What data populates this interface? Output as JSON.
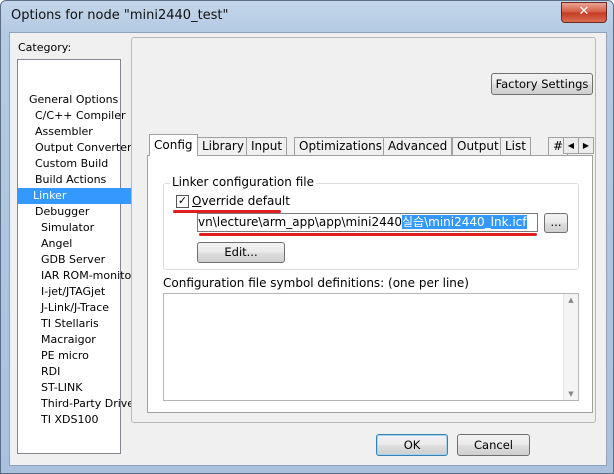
{
  "window": {
    "title": "Options for node \"mini2440_test\"",
    "close_glyph": "✕"
  },
  "category": {
    "label": "Category:",
    "items": [
      {
        "label": "General Options",
        "indent": 0,
        "selected": false
      },
      {
        "label": "C/C++ Compiler",
        "indent": 1,
        "selected": false
      },
      {
        "label": "Assembler",
        "indent": 1,
        "selected": false
      },
      {
        "label": "Output Converter",
        "indent": 1,
        "selected": false
      },
      {
        "label": "Custom Build",
        "indent": 1,
        "selected": false
      },
      {
        "label": "Build Actions",
        "indent": 1,
        "selected": false
      },
      {
        "label": "Linker",
        "indent": 1,
        "selected": true
      },
      {
        "label": "Debugger",
        "indent": 1,
        "selected": false
      },
      {
        "label": "Simulator",
        "indent": 2,
        "selected": false
      },
      {
        "label": "Angel",
        "indent": 2,
        "selected": false
      },
      {
        "label": "GDB Server",
        "indent": 2,
        "selected": false
      },
      {
        "label": "IAR ROM-monitor",
        "indent": 2,
        "selected": false
      },
      {
        "label": "I-jet/JTAGjet",
        "indent": 2,
        "selected": false
      },
      {
        "label": "J-Link/J-Trace",
        "indent": 2,
        "selected": false
      },
      {
        "label": "TI Stellaris",
        "indent": 2,
        "selected": false
      },
      {
        "label": "Macraigor",
        "indent": 2,
        "selected": false
      },
      {
        "label": "PE micro",
        "indent": 2,
        "selected": false
      },
      {
        "label": "RDI",
        "indent": 2,
        "selected": false
      },
      {
        "label": "ST-LINK",
        "indent": 2,
        "selected": false
      },
      {
        "label": "Third-Party Driver",
        "indent": 2,
        "selected": false
      },
      {
        "label": "TI XDS100",
        "indent": 2,
        "selected": false
      }
    ]
  },
  "factory_settings_label": "Factory Settings",
  "tabs": [
    "Config",
    "Library",
    "Input",
    "Optimizations",
    "Advanced",
    "Output",
    "List",
    "#"
  ],
  "active_tab": "Config",
  "config": {
    "linker_group_label": "Linker configuration file",
    "override_default_label": "Override default",
    "override_checked": true,
    "check_glyph": "✓",
    "path_plain": "vn\\lecture\\arm_app\\app\\mini2440",
    "path_selected": "실습\\mini2440_lnk.icf",
    "browse_label": "...",
    "edit_label": "Edit...",
    "symbol_defs_label": "Configuration file symbol definitions: (one per line)",
    "symbol_defs_value": ""
  },
  "footer": {
    "ok_label": "OK",
    "cancel_label": "Cancel"
  },
  "colors": {
    "selection": "#3399ff",
    "annotation": "#e02020",
    "accent_border": "#3c7fb1"
  }
}
